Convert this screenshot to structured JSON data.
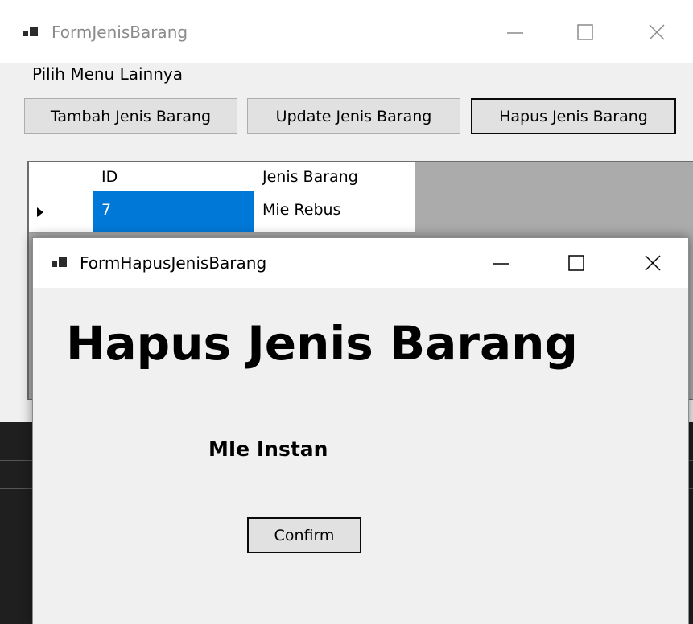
{
  "main_window": {
    "title": "FormJenisBarang",
    "menu_label": "Pilih Menu Lainnya",
    "buttons": {
      "tambah": "Tambah Jenis Barang",
      "update": "Update Jenis Barang",
      "hapus": "Hapus Jenis Barang"
    },
    "grid": {
      "columns": [
        "ID",
        "Jenis Barang"
      ],
      "rows": [
        {
          "id": "7",
          "jenis": "Mie Rebus"
        }
      ]
    }
  },
  "dialog": {
    "title": "FormHapusJenisBarang",
    "heading": "Hapus Jenis Barang",
    "item_name": "MIe Instan",
    "confirm_label": "Confirm"
  }
}
